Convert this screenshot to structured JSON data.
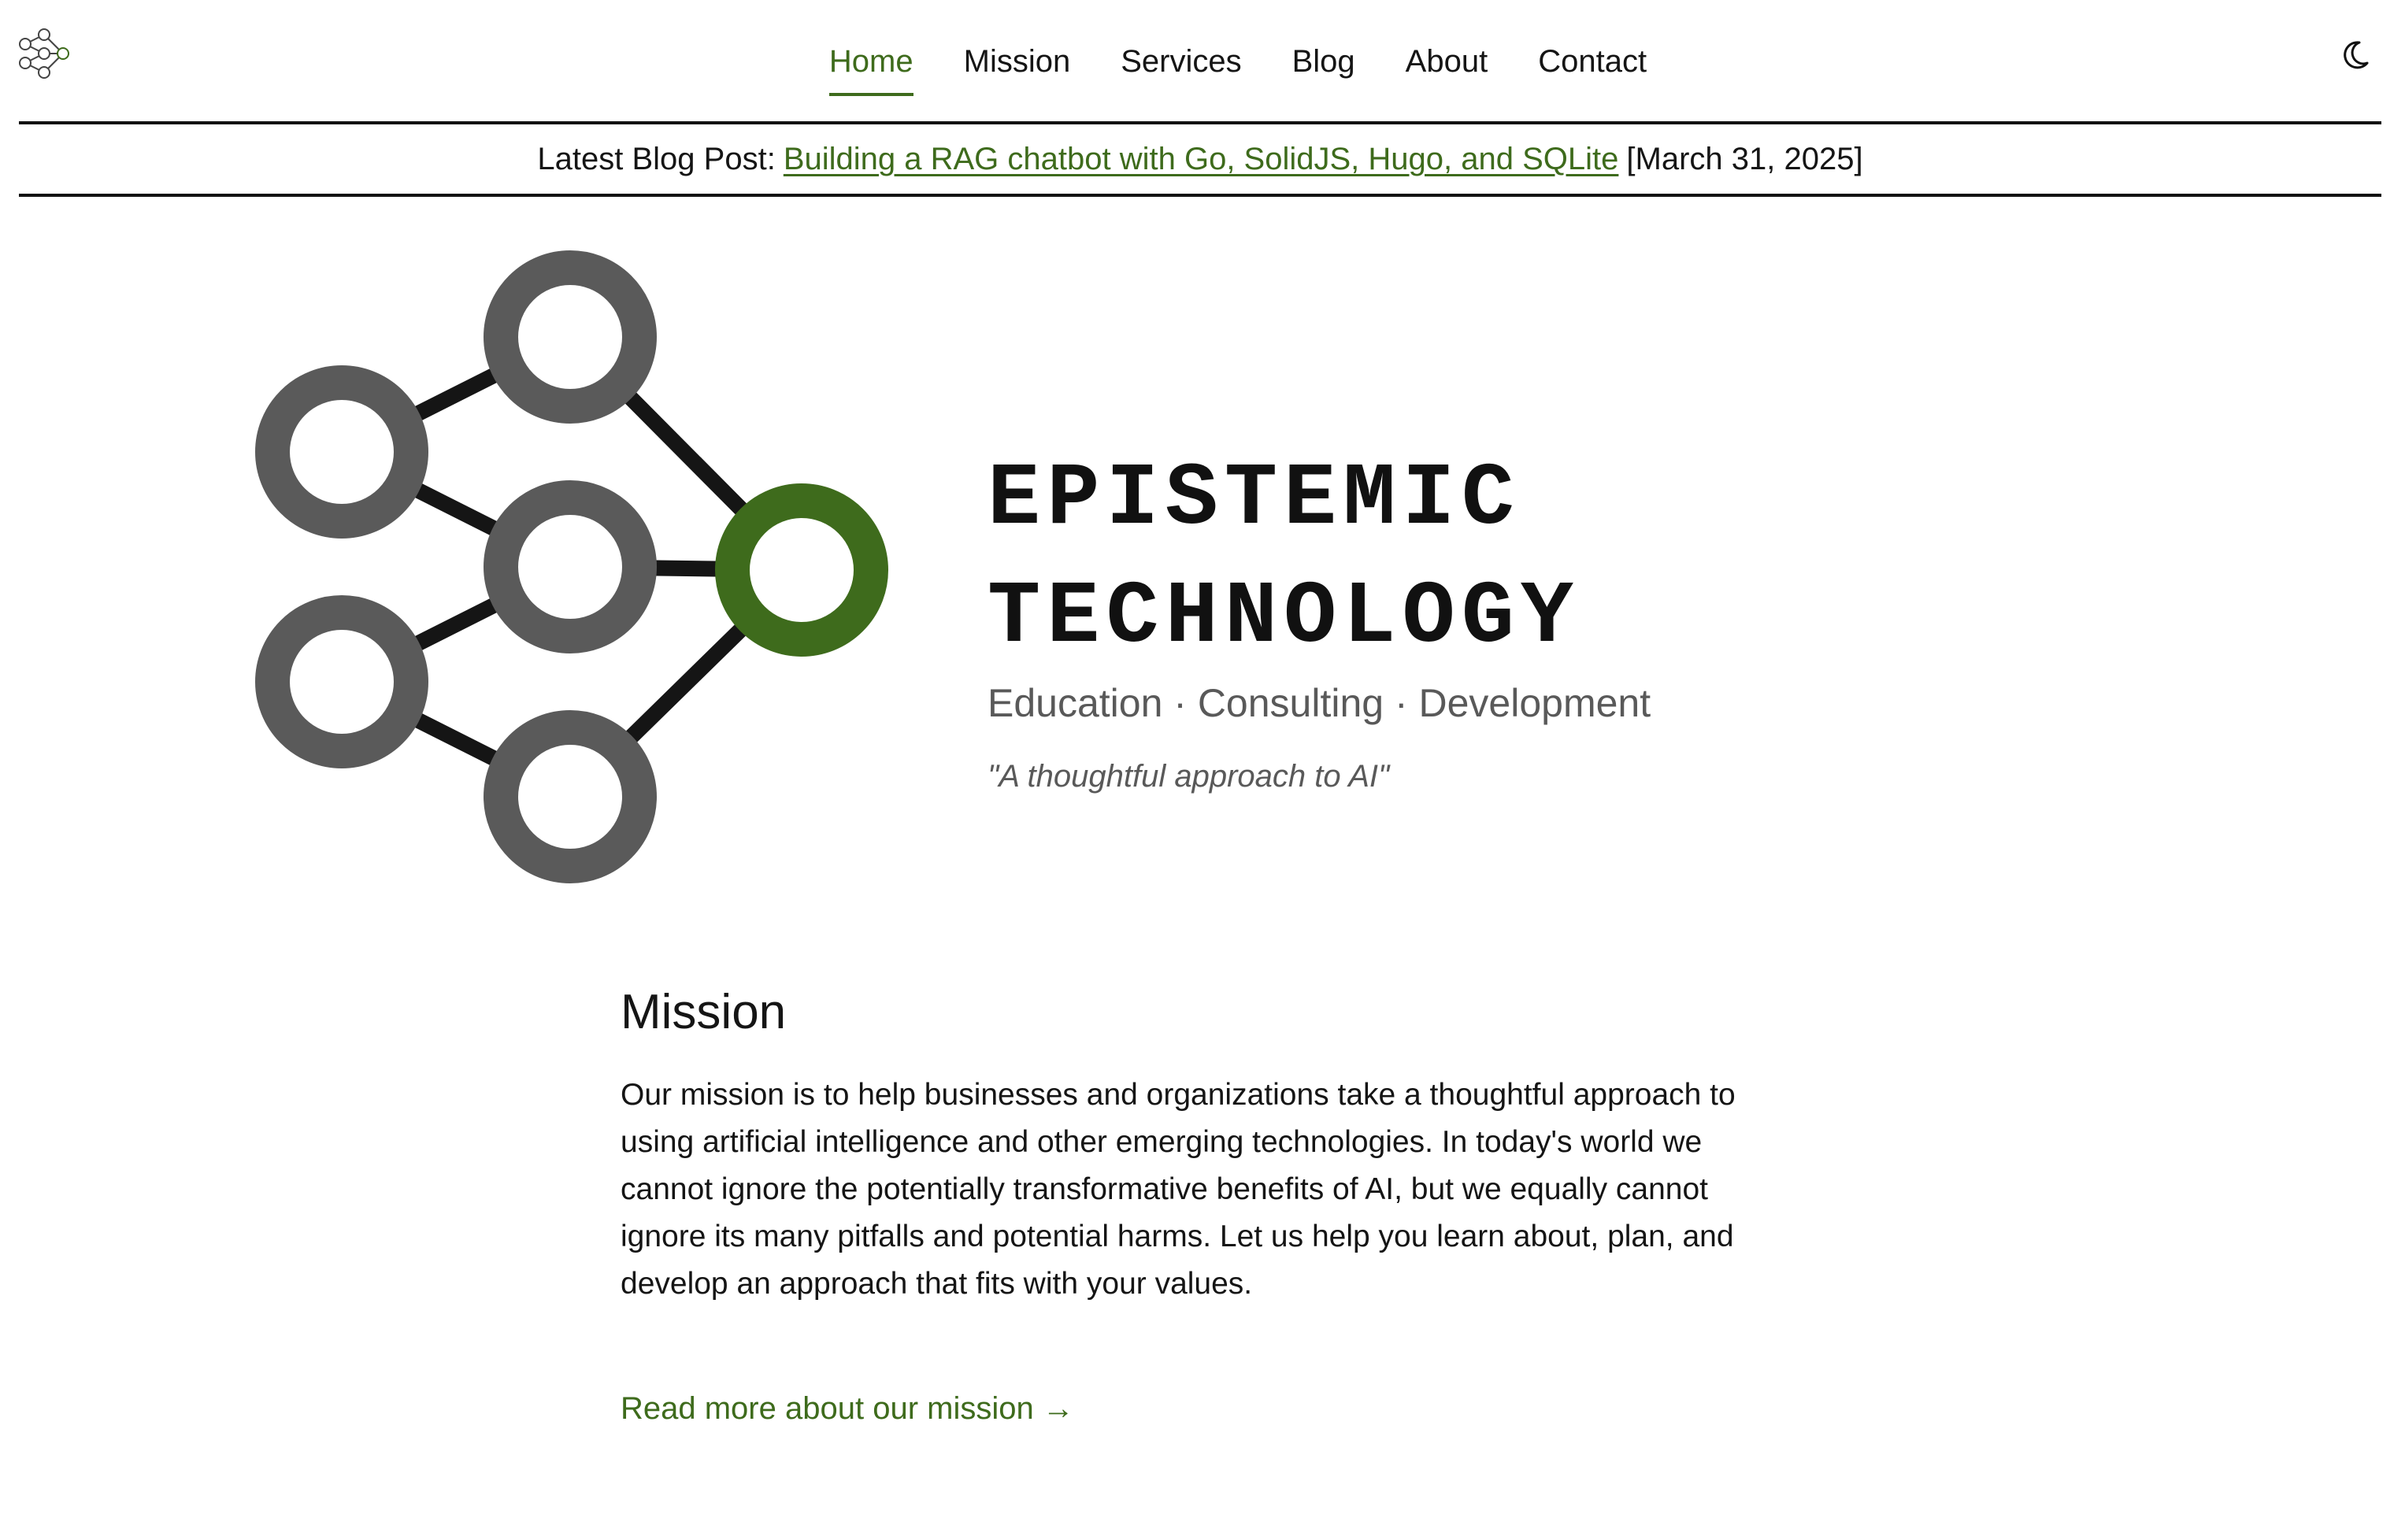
{
  "nav": {
    "items": [
      {
        "label": "Home",
        "active": true
      },
      {
        "label": "Mission",
        "active": false
      },
      {
        "label": "Services",
        "active": false
      },
      {
        "label": "Blog",
        "active": false
      },
      {
        "label": "About",
        "active": false
      },
      {
        "label": "Contact",
        "active": false
      }
    ]
  },
  "theme_toggle": {
    "icon": "moon-icon"
  },
  "site_logo": {
    "icon": "network-logo-icon"
  },
  "banner": {
    "prefix": "Latest Blog Post:",
    "link_text": "Building a RAG chatbot with Go, SolidJS, Hugo, and SQLite",
    "date": "[March 31, 2025]"
  },
  "hero": {
    "title": "EPISTEMIC TECHNOLOGY",
    "subtitle": "Education · Consulting · Development",
    "tagline": "\"A thoughtful approach to AI\"",
    "graphic_icon": "neural-network-logo"
  },
  "mission": {
    "heading": "Mission",
    "body": "Our mission is to help businesses and organizations take a thoughtful approach to using artificial intelligence and other emerging technologies. In today's world we cannot ignore the potentially transformative benefits of AI, but we equally cannot ignore its many pitfalls and potential harms. Let us help you learn about, plan, and develop an approach that fits with your values.",
    "link": "Read more about our mission →"
  },
  "colors": {
    "accent": "#3e6b1c",
    "node_gray": "#5a5a5a",
    "text": "#151515",
    "muted": "#595959"
  }
}
